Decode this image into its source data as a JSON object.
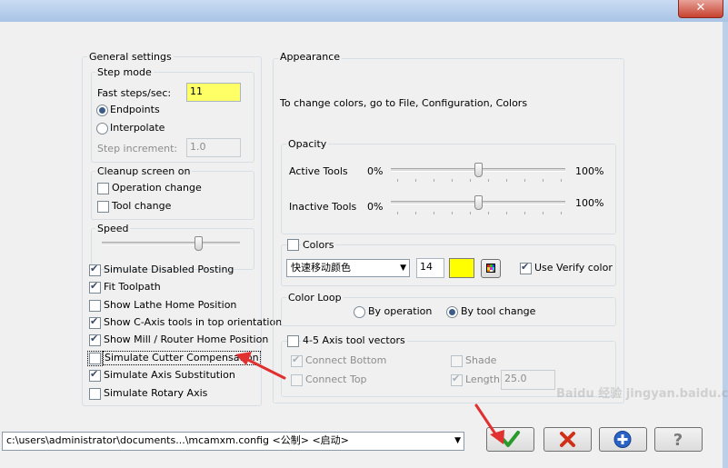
{
  "window": {
    "close_label": "✕"
  },
  "general": {
    "title": "General settings",
    "step_mode": {
      "title": "Step mode",
      "fast_steps_label": "Fast steps/sec:",
      "fast_steps_value": "11",
      "endpoints_label": "Endpoints",
      "interpolate_label": "Interpolate",
      "step_increment_label": "Step increment:",
      "step_increment_value": "1.0"
    },
    "cleanup": {
      "title": "Cleanup screen on",
      "operation_change": "Operation change",
      "tool_change": "Tool change"
    },
    "speed": {
      "title": "Speed",
      "level": 0.7
    },
    "options": [
      {
        "label": "Simulate Disabled Posting",
        "checked": true
      },
      {
        "label": "Fit Toolpath",
        "checked": true
      },
      {
        "label": "Show Lathe Home Position",
        "checked": false
      },
      {
        "label": "Show C-Axis tools in top orientation",
        "checked": true
      },
      {
        "label": "Show Mill / Router Home Position",
        "checked": true
      },
      {
        "label": "Simulate Cutter Compensation",
        "checked": false
      },
      {
        "label": "Simulate Axis Substitution",
        "checked": true
      },
      {
        "label": "Simulate Rotary Axis",
        "checked": false
      }
    ]
  },
  "appearance": {
    "title": "Appearance",
    "hint": "To change colors, go to File, Configuration, Colors",
    "opacity": {
      "title": "Opacity",
      "active_label": "Active Tools",
      "inactive_label": "Inactive Tools",
      "min_label": "0%",
      "max_label": "100%",
      "active_level": 0.5,
      "inactive_level": 0.5
    },
    "colors": {
      "title": "Colors",
      "dropdown_value": "快速移动颜色",
      "number_value": "14",
      "swatch_color": "#ffff00",
      "use_verify_label": "Use Verify color"
    },
    "color_loop": {
      "title": "Color Loop",
      "by_operation": "By operation",
      "by_tool_change": "By tool change"
    },
    "axis_vectors": {
      "title": "4-5 Axis tool vectors",
      "connect_bottom": "Connect Bottom",
      "connect_top": "Connect Top",
      "shade": "Shade",
      "length_label": "Length",
      "length_value": "25.0"
    }
  },
  "footer": {
    "path_value": "c:\\users\\administrator\\documents...\\mcamxm.config <公制> <启动>",
    "ok_icon": "check-icon",
    "cancel_icon": "cancel-icon",
    "add_icon": "add-icon",
    "help_icon": "help-icon"
  },
  "watermark": "Baidu 经验 jingyan.baidu.com"
}
